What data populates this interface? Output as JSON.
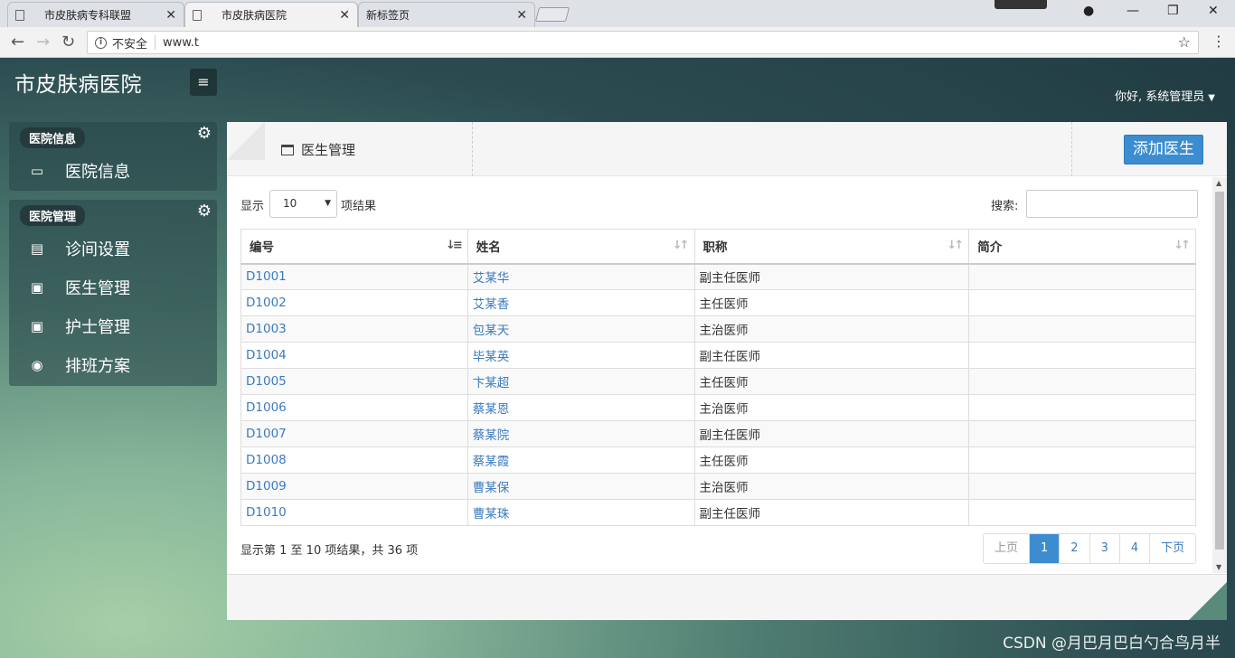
{
  "browser": {
    "tabs": [
      {
        "title": "市皮肤病专科联盟",
        "active": false
      },
      {
        "title": "市皮肤病医院",
        "active": true
      },
      {
        "title": "新标签页",
        "active": false
      }
    ],
    "security_label": "不安全",
    "url": "www.t"
  },
  "app": {
    "brand": "市皮肤病医院",
    "user_greeting": "你好, 系统管理员"
  },
  "sidebar": {
    "groups": [
      {
        "title": "医院信息",
        "items": [
          {
            "label": "医院信息",
            "icon": "window-icon"
          }
        ]
      },
      {
        "title": "医院管理",
        "items": [
          {
            "label": "诊间设置",
            "icon": "document-icon"
          },
          {
            "label": "医生管理",
            "icon": "monitor-icon"
          },
          {
            "label": "护士管理",
            "icon": "monitor-icon"
          },
          {
            "label": "排班方案",
            "icon": "map-pin-icon"
          }
        ]
      }
    ]
  },
  "main": {
    "title": "医生管理",
    "add_button": "添加医生",
    "length": {
      "prefix": "显示",
      "value": "10",
      "suffix": "项结果"
    },
    "search_label": "搜索:",
    "table": {
      "columns": [
        "编号",
        "姓名",
        "职称",
        "简介"
      ],
      "rows": [
        {
          "id": "D1001",
          "name": "艾某华",
          "title": "副主任医师",
          "intro": ""
        },
        {
          "id": "D1002",
          "name": "艾某香",
          "title": "主任医师",
          "intro": ""
        },
        {
          "id": "D1003",
          "name": "包某天",
          "title": "主治医师",
          "intro": ""
        },
        {
          "id": "D1004",
          "name": "毕某英",
          "title": "副主任医师",
          "intro": ""
        },
        {
          "id": "D1005",
          "name": "卞某超",
          "title": "主任医师",
          "intro": ""
        },
        {
          "id": "D1006",
          "name": "蔡某恩",
          "title": "主治医师",
          "intro": ""
        },
        {
          "id": "D1007",
          "name": "蔡某院",
          "title": "副主任医师",
          "intro": ""
        },
        {
          "id": "D1008",
          "name": "蔡某霞",
          "title": "主任医师",
          "intro": ""
        },
        {
          "id": "D1009",
          "name": "曹某保",
          "title": "主治医师",
          "intro": ""
        },
        {
          "id": "D1010",
          "name": "曹某珠",
          "title": "副主任医师",
          "intro": ""
        }
      ]
    },
    "info": "显示第 1 至 10 项结果，共 36 项",
    "pager": {
      "prev": "上页",
      "pages": [
        "1",
        "2",
        "3",
        "4"
      ],
      "current": "1",
      "next": "下页"
    }
  },
  "watermark": "CSDN @月巴月巴白勺合鸟月半",
  "colors": {
    "accent": "#3c8dd0",
    "link": "#3a7bbf"
  }
}
